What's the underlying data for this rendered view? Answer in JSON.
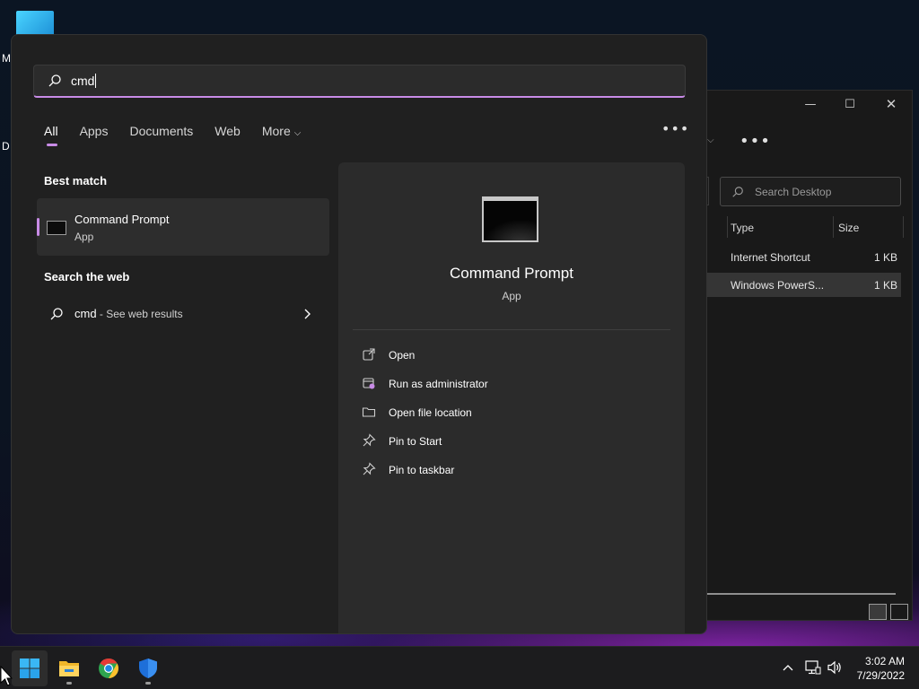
{
  "desktop": {
    "label_m": "M",
    "label_d": "D"
  },
  "explorer": {
    "controls": {
      "minimize": "—",
      "maximize": "☐",
      "close": "✕"
    },
    "search_placeholder": "Search Desktop",
    "columns": {
      "type": "Type",
      "size": "Size"
    },
    "rows": [
      {
        "type": "Internet Shortcut",
        "size": "1 KB"
      },
      {
        "type": "Windows PowerS...",
        "size": "1 KB"
      }
    ]
  },
  "search": {
    "query": "cmd",
    "tabs": [
      "All",
      "Apps",
      "Documents",
      "Web",
      "More"
    ],
    "more_chevron": "⌵",
    "ellipsis": "•••",
    "best_match_heading": "Best match",
    "best_match": {
      "name": "Command Prompt",
      "type": "App"
    },
    "web_heading": "Search the web",
    "web_result": {
      "query": "cmd",
      "suffix": " - See web results"
    },
    "detail": {
      "name": "Command Prompt",
      "type": "App",
      "actions": [
        {
          "label": "Open",
          "icon": "open-external-icon"
        },
        {
          "label": "Run as administrator",
          "icon": "shield-admin-icon"
        },
        {
          "label": "Open file location",
          "icon": "folder-icon"
        },
        {
          "label": "Pin to Start",
          "icon": "pin-icon"
        },
        {
          "label": "Pin to taskbar",
          "icon": "pin-icon"
        }
      ]
    }
  },
  "taskbar": {
    "apps": [
      "start-button",
      "file-explorer",
      "chrome",
      "windows-security"
    ],
    "clock": {
      "time": "3:02 AM",
      "date": "7/29/2022"
    }
  },
  "colors": {
    "accent": "#c88be6",
    "panel_bg": "#202020",
    "detail_bg": "#2b2b2b",
    "taskbar_bg": "#1c1c1e"
  }
}
